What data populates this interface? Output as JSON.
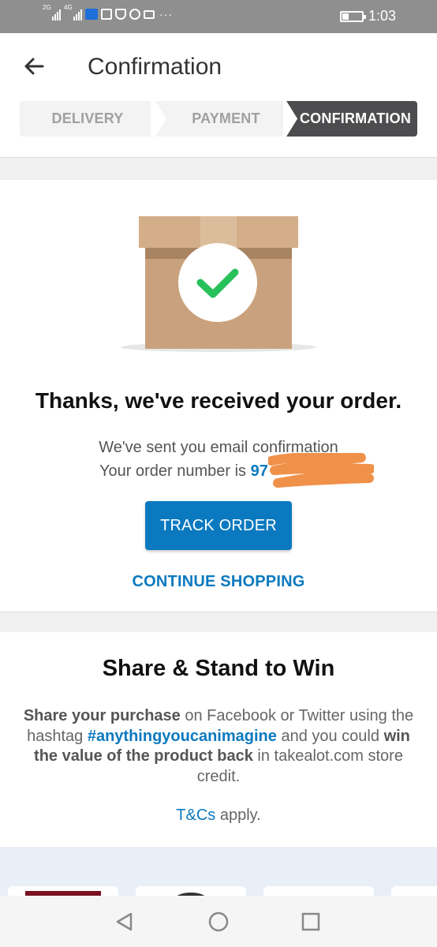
{
  "status_bar": {
    "signal1_label": "2G",
    "signal2_label": "4G",
    "more": "···",
    "time": "1:03",
    "icons": [
      "signal-icon",
      "signal-icon",
      "app-notification-icon",
      "news-icon",
      "shield-icon",
      "whatsapp-icon",
      "mail-icon",
      "more-dots-icon",
      "battery-icon"
    ]
  },
  "header": {
    "title": "Confirmation",
    "back_icon": "arrow-left-icon"
  },
  "steps": [
    {
      "label": "DELIVERY",
      "active": false
    },
    {
      "label": "PAYMENT",
      "active": false
    },
    {
      "label": "CONFIRMATION",
      "active": true
    }
  ],
  "order": {
    "illustration": "box-check-icon",
    "thanks": "Thanks, we've received your order.",
    "email_sent": "We've sent you email confirmation",
    "order_number_prefix": "Your order number is",
    "order_number_visible": "97",
    "track_button": "TRACK ORDER",
    "continue_link": "CONTINUE SHOPPING"
  },
  "share": {
    "title": "Share & Stand to Win",
    "text_bold1": "Share your purchase",
    "text_part1": "on Facebook or Twitter using the hashtag",
    "hashtag": "#anythingyoucanimagine",
    "text_part2": "and you could",
    "text_bold2": "win the value of the product back",
    "text_part3": "in takealot.com store credit.",
    "tcs_link": "T&Cs",
    "tcs_suffix": "apply."
  },
  "colors": {
    "accent_blue": "#0b79bf",
    "active_step_bg": "#4d4d4f",
    "box_brown": "#c8a27c",
    "check_green": "#27c05a",
    "redaction_orange": "#f0914a"
  },
  "nav_bar": {
    "icons": [
      "back-triangle-icon",
      "home-circle-icon",
      "recents-square-icon"
    ]
  }
}
